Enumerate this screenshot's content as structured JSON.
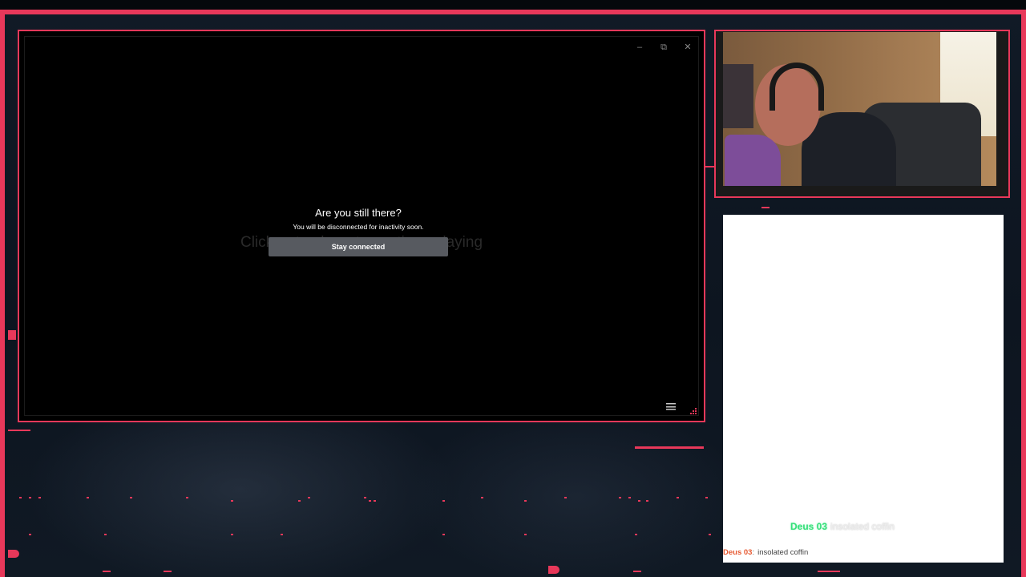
{
  "window_controls": {
    "minimize": "–",
    "restore": "⧉",
    "close": "✕"
  },
  "game": {
    "background_prompt": "Click or tap here to continue playing"
  },
  "dialog": {
    "title": "Are you still there?",
    "message": "You will be disconnected for inactivity soon.",
    "button_label": "Stay connected"
  },
  "chat": {
    "overlay_message": {
      "user": "Deus 03",
      "text": "insolated coffin"
    },
    "messages": [
      {
        "user": "Deus 03",
        "separator": ":",
        "text": "insolated coffin"
      }
    ]
  },
  "colors": {
    "frame_accent": "#e8385a",
    "chat_user_overlay": "#35e07a",
    "chat_user": "#e65a32",
    "button_bg": "#575a60"
  },
  "icons": {
    "menu": "hamburger-menu-icon",
    "minimize": "minimize-icon",
    "restore": "restore-icon",
    "close": "close-icon"
  }
}
